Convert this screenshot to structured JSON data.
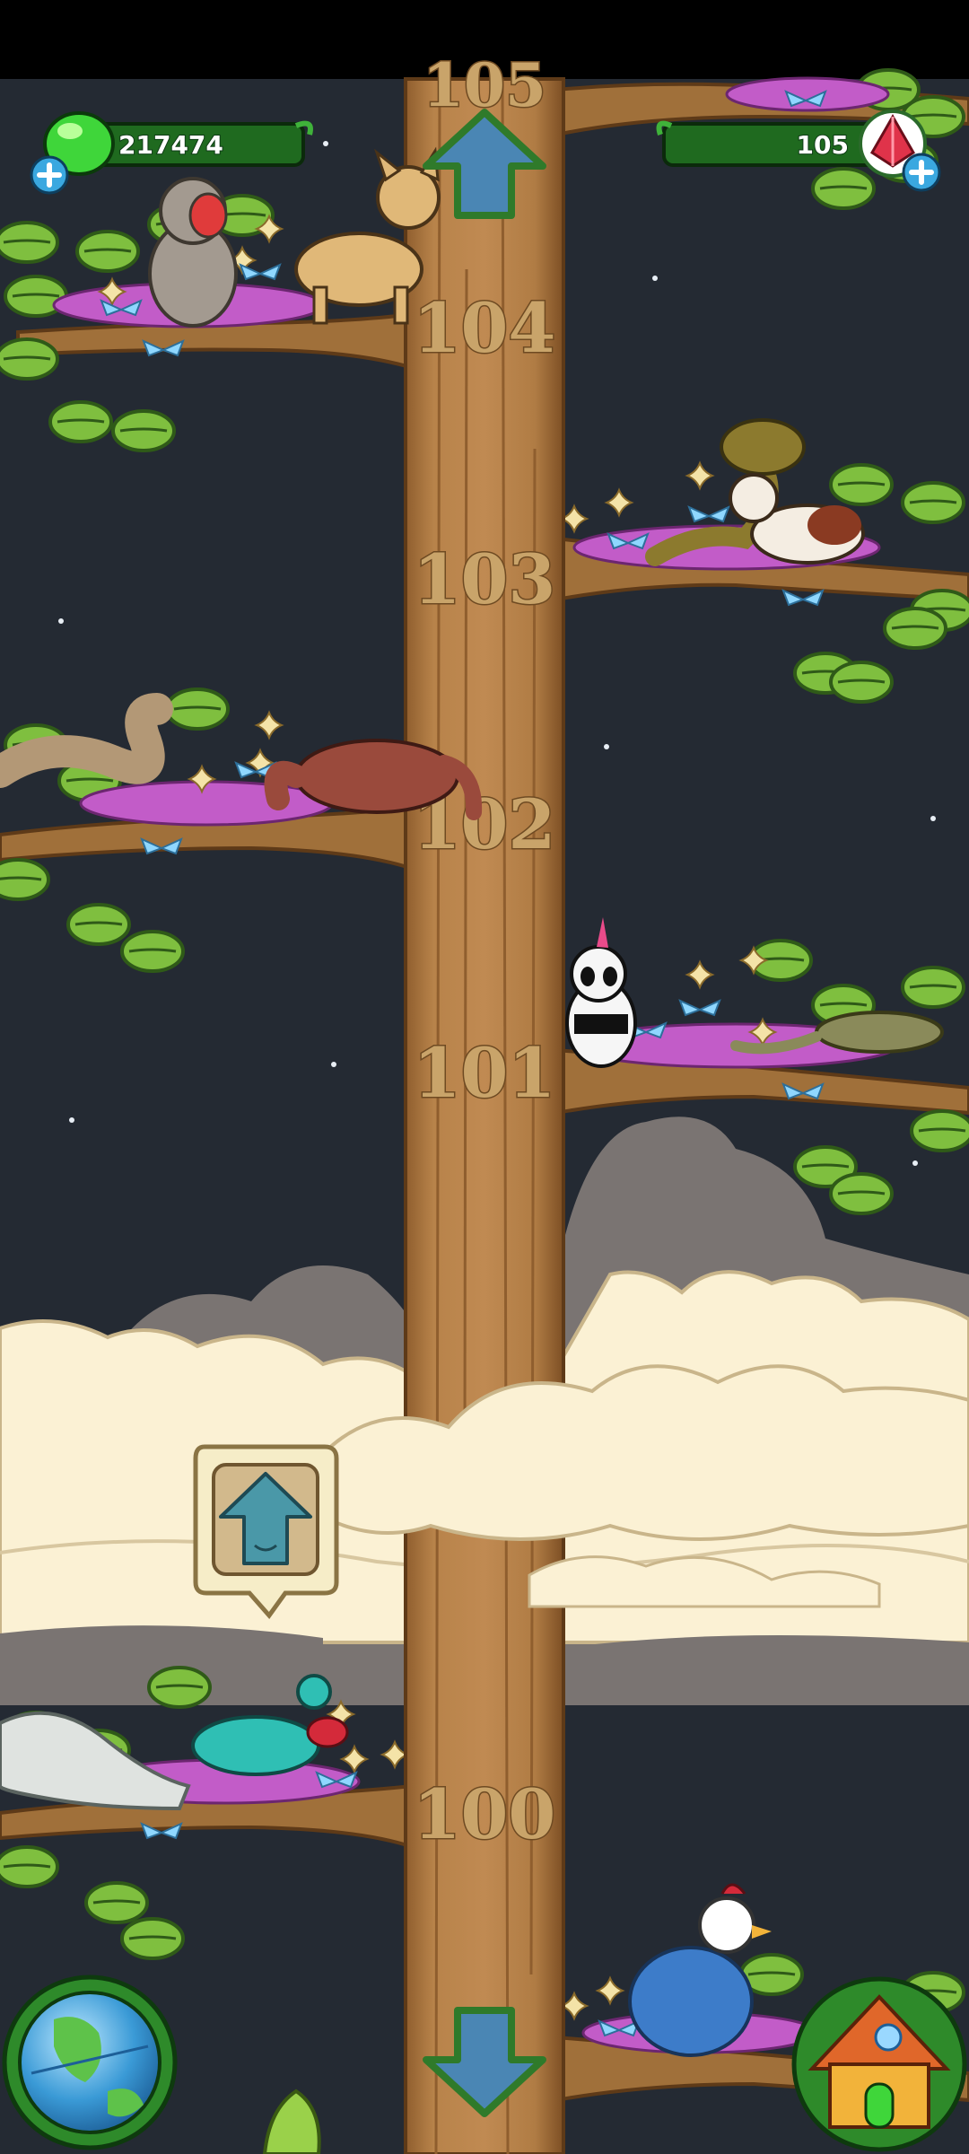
{
  "hud": {
    "gems": "217474",
    "crystals": "105"
  },
  "floors": [
    "105",
    "104",
    "103",
    "102",
    "101",
    "100"
  ],
  "colors": {
    "sky": "#242a33",
    "trunk": "#b07c44",
    "trunk_dark": "#8a5a2c",
    "leaf": "#7fbf3f",
    "leaf_dark": "#2f6a1c",
    "hud_green": "#2f9a2a",
    "arrow_blue": "#4a86b4"
  },
  "icons": {
    "gem": "green-gem-icon",
    "crystal": "red-crystal-icon",
    "up": "up-arrow-icon",
    "down": "down-arrow-icon",
    "world": "globe-icon",
    "home": "house-icon",
    "habitat": "habitat-up-icon"
  }
}
